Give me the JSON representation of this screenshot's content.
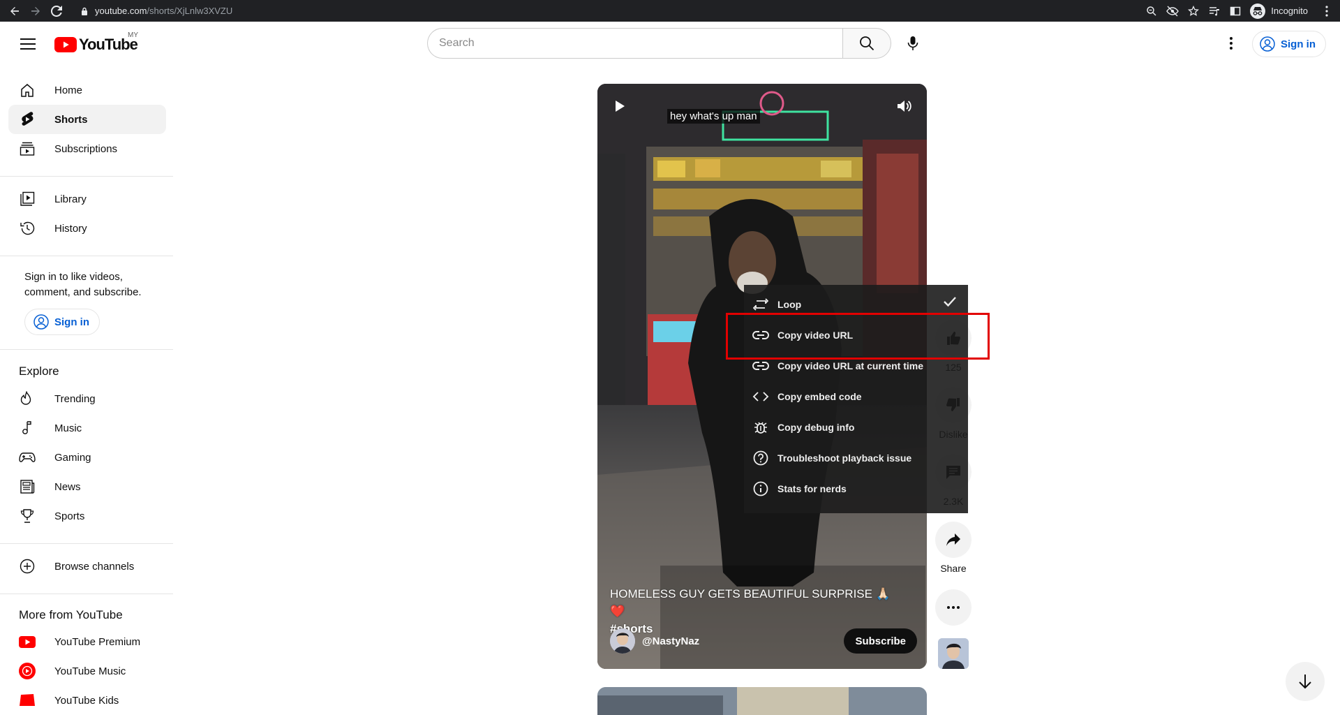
{
  "browser": {
    "url_host": "youtube.com",
    "url_path": "/shorts/XjLnlw3XVZU",
    "incognito_label": "Incognito"
  },
  "header": {
    "logo_text": "YouTube",
    "country_code": "MY",
    "search_placeholder": "Search",
    "sign_in_label": "Sign in"
  },
  "sidebar": {
    "main": [
      {
        "label": "Home",
        "icon": "home-icon"
      },
      {
        "label": "Shorts",
        "icon": "shorts-icon",
        "active": true
      },
      {
        "label": "Subscriptions",
        "icon": "subscriptions-icon"
      }
    ],
    "library": [
      {
        "label": "Library",
        "icon": "library-icon"
      },
      {
        "label": "History",
        "icon": "history-icon"
      }
    ],
    "signin_prompt": "Sign in to like videos, comment, and subscribe.",
    "signin_button": "Sign in",
    "explore_heading": "Explore",
    "explore": [
      {
        "label": "Trending",
        "icon": "trending-icon"
      },
      {
        "label": "Music",
        "icon": "music-icon"
      },
      {
        "label": "Gaming",
        "icon": "gaming-icon"
      },
      {
        "label": "News",
        "icon": "news-icon"
      },
      {
        "label": "Sports",
        "icon": "sports-icon"
      }
    ],
    "browse_channels": "Browse channels",
    "more_heading": "More from YouTube",
    "more": [
      {
        "label": "YouTube Premium",
        "icon": "youtube-premium-icon"
      },
      {
        "label": "YouTube Music",
        "icon": "youtube-music-icon"
      },
      {
        "label": "YouTube Kids",
        "icon": "youtube-kids-icon"
      }
    ]
  },
  "video": {
    "caption": "hey what's up man",
    "title": "HOMELESS GUY GETS BEAUTIFUL SURPRISE 🙏🏻❤️",
    "hashtag": "#shorts",
    "channel": "@NastyNaz",
    "subscribe_label": "Subscribe"
  },
  "actions": {
    "like_count": "125",
    "dislike_label": "Dislike",
    "comment_count": "2.3K",
    "share_label": "Share"
  },
  "context_menu": {
    "items": [
      {
        "label": "Loop",
        "icon": "loop-icon",
        "checked": true
      },
      {
        "label": "Copy video URL",
        "icon": "link-icon"
      },
      {
        "label": "Copy video URL at current time",
        "icon": "link-icon"
      },
      {
        "label": "Copy embed code",
        "icon": "embed-code-icon"
      },
      {
        "label": "Copy debug info",
        "icon": "debug-icon"
      },
      {
        "label": "Troubleshoot playback issue",
        "icon": "help-icon"
      },
      {
        "label": "Stats for nerds",
        "icon": "info-icon"
      }
    ]
  },
  "colors": {
    "youtube_red": "#ff0000",
    "link_blue": "#065fd4",
    "highlight_red": "#e20000"
  }
}
